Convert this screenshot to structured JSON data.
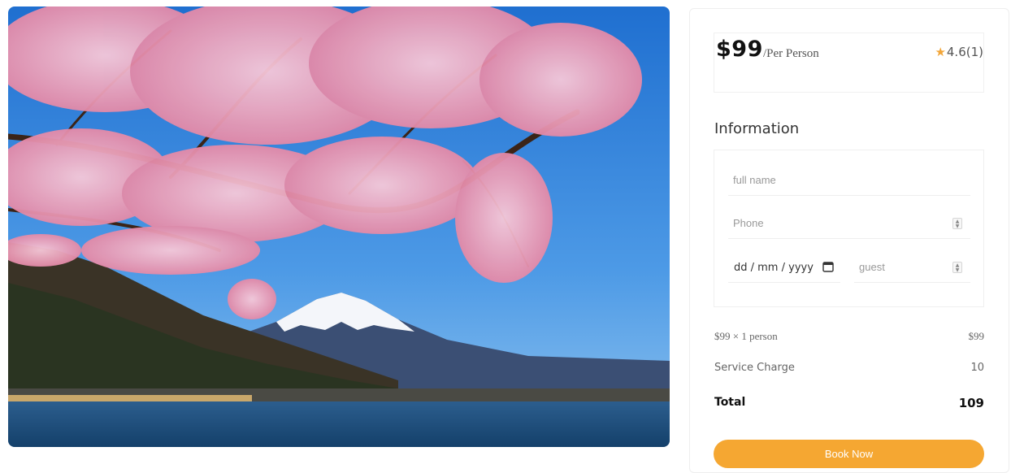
{
  "hero": {
    "description_icon": "mountain-cherry-blossom-photo"
  },
  "pricing": {
    "price": "$99",
    "per_label": "/Per Person",
    "rating": "4.6(1)",
    "star_color": "#f2a63a"
  },
  "form": {
    "title": "Information",
    "name_placeholder": "full name",
    "phone_placeholder": "Phone",
    "date_placeholder": "dd / mm / yyyy",
    "guest_placeholder": "guest"
  },
  "summary": {
    "line1_label": "$99 × 1 person",
    "line1_value": "$99",
    "service_label": "Service Charge",
    "service_value": "10",
    "total_label": "Total",
    "total_value": "109"
  },
  "actions": {
    "book_label": "Book Now",
    "book_color": "#f5a732"
  }
}
